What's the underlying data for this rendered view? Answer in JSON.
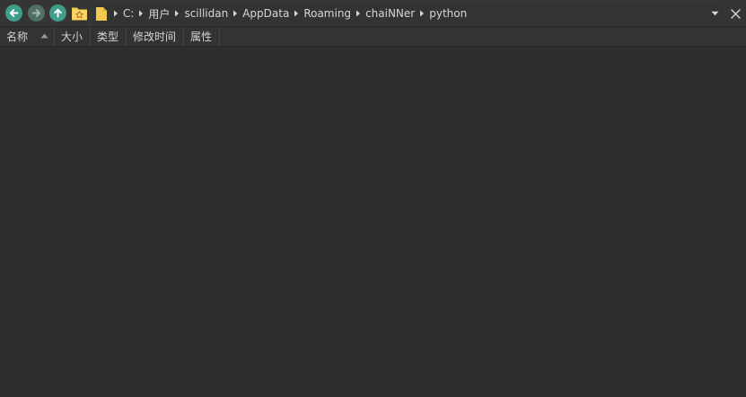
{
  "toolbar": {
    "back_icon": "arrow-left-icon",
    "forward_icon": "arrow-right-icon",
    "up_icon": "arrow-up-icon",
    "favorites_icon": "star-folder-icon",
    "colors": {
      "nav_button": "#3f9e8a",
      "nav_button_disabled": "#4e6e66",
      "folder_yellow": "#f2c94c"
    }
  },
  "address_bar": {
    "breadcrumbs": [
      "C:",
      "用户",
      "scillidan",
      "AppData",
      "Roaming",
      "chaiNNer",
      "python"
    ]
  },
  "columns": {
    "name": "名称",
    "size": "大小",
    "type": "类型",
    "modified": "修改时间",
    "attributes": "属性",
    "sort_direction": "ascending"
  }
}
